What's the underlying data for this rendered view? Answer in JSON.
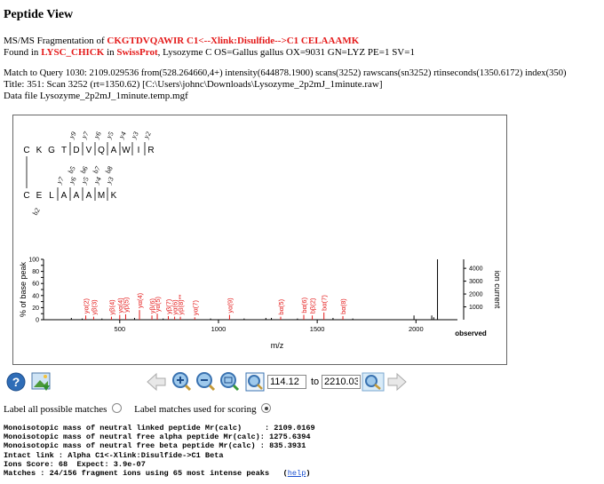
{
  "page_title": "Peptide View",
  "frag": {
    "prefix": "MS/MS Fragmentation of ",
    "peptide": "CKGTDVQAWIR C1<--Xlink:Disulfide-->C1 CELAAAMK"
  },
  "found": {
    "prefix": "Found in ",
    "accession": "LYSC_CHICK",
    "mid": " in ",
    "db": "SwissProt",
    "rest": ", Lysozyme C OS=Gallus gallus OX=9031 GN=LYZ PE=1 SV=1"
  },
  "match_line": "Match to Query 1030: 2109.029536 from(528.264660,4+) intensity(644878.1900) scans(3252) rawscans(sn3252) rtinseconds(1350.6172) index(350)",
  "title_line": "Title: 351: Scan 3252 (rt=1350.62) [C:\\Users\\johnc\\Downloads\\Lysozyme_2p2mJ_1minute.raw]",
  "datafile_line": "Data file Lysozyme_2p2mJ_1minute.temp.mgf",
  "alpha_seq": [
    "C",
    "K",
    "G",
    "T",
    "D",
    "V",
    "Q",
    "A",
    "W",
    "I",
    "R"
  ],
  "alpha_top_labels": [
    "y9",
    "y7",
    "y6",
    "y5",
    "y4",
    "y3",
    "y2"
  ],
  "alpha_bot_labels": [
    "b5",
    "b6",
    "b7",
    "b8"
  ],
  "beta_seq": [
    "C",
    "E",
    "L",
    "A",
    "A",
    "A",
    "M",
    "K"
  ],
  "beta_top_labels": [
    "y7",
    "y6",
    "y5",
    "y4",
    "y3"
  ],
  "beta_bot_labels": [
    "b2"
  ],
  "chart_data": {
    "type": "bar",
    "xlabel": "m/z",
    "ylabel": "% of base peak",
    "y2label": "ion current",
    "observed_label": "observed",
    "xlim": [
      114.12,
      2210.03
    ],
    "ylim": [
      0,
      100
    ],
    "y2lim": [
      0,
      4700
    ],
    "xticks": [
      500,
      1000,
      1500,
      2000
    ],
    "yticks": [
      0,
      10,
      20,
      30,
      40,
      50,
      60,
      70,
      80,
      90,
      100
    ],
    "y2ticks": [
      1000,
      2000,
      3000,
      4000
    ],
    "matched_color": "#e41a1a",
    "unmatched_color": "#000000",
    "matched_peaks": [
      {
        "mz": 328,
        "y": 7,
        "label": "yα(2)"
      },
      {
        "mz": 368,
        "y": 5,
        "label": "yβ(3)"
      },
      {
        "mz": 458,
        "y": 5,
        "label": "yβ(4)"
      },
      {
        "mz": 500,
        "y": 8,
        "label": "yα(4)"
      },
      {
        "mz": 530,
        "y": 9,
        "label": "yβ(5)"
      },
      {
        "mz": 600,
        "y": 16,
        "label": "yα(4)"
      },
      {
        "mz": 663,
        "y": 7,
        "label": "yβ(6)"
      },
      {
        "mz": 690,
        "y": 10,
        "label": "yα(5)"
      },
      {
        "mz": 746,
        "y": 6,
        "label": "yβ(7)"
      },
      {
        "mz": 778,
        "y": 5,
        "label": "yα(6)"
      },
      {
        "mz": 807,
        "y": 5,
        "label": "yβ(8)**"
      },
      {
        "mz": 880,
        "y": 4,
        "label": "yα(7)"
      },
      {
        "mz": 1056,
        "y": 8,
        "label": "yα(9)"
      },
      {
        "mz": 1315,
        "y": 5,
        "label": "bα(5)"
      },
      {
        "mz": 1432,
        "y": 8,
        "label": "bα(6)"
      },
      {
        "mz": 1475,
        "y": 7,
        "label": "bβ(2)"
      },
      {
        "mz": 1534,
        "y": 12,
        "label": "bα(7)"
      },
      {
        "mz": 1630,
        "y": 6,
        "label": "bα(8)"
      }
    ],
    "other_peaks": [
      {
        "mz": 255,
        "y": 3
      },
      {
        "mz": 310,
        "y": 2
      },
      {
        "mz": 410,
        "y": 2
      },
      {
        "mz": 575,
        "y": 3
      },
      {
        "mz": 720,
        "y": 2
      },
      {
        "mz": 960,
        "y": 2
      },
      {
        "mz": 1130,
        "y": 2
      },
      {
        "mz": 1240,
        "y": 3
      },
      {
        "mz": 1268,
        "y": 3
      },
      {
        "mz": 1400,
        "y": 2
      },
      {
        "mz": 1580,
        "y": 3
      },
      {
        "mz": 1680,
        "y": 2
      },
      {
        "mz": 1990,
        "y": 7
      },
      {
        "mz": 2080,
        "y": 7
      },
      {
        "mz": 2090,
        "y": 4
      },
      {
        "mz": 2109,
        "y": 100
      }
    ]
  },
  "range": {
    "from": "114.12",
    "to_label": "to",
    "to": "2210.03"
  },
  "radios": {
    "all_label": "Label all possible matches",
    "scoring_label": "Label matches used for scoring"
  },
  "mono_lines": [
    "Monoisotopic mass of neutral linked peptide Mr(calc)     : 2109.0169",
    "Monoisotopic mass of neutral free alpha peptide Mr(calc): 1275.6394",
    "Monoisotopic mass of neutral free beta peptide Mr(calc) : 835.3931",
    "Intact link : Alpha C1<-Xlink:Disulfide->C1 Beta",
    "Ions Score: 68  Expect: 3.9e-07"
  ],
  "matches_text": "Matches : 24/156 fragment ions using 65 most intense peaks   (",
  "help_label": "help",
  "matches_close": ")",
  "icons": {
    "help": "help-icon",
    "export": "export-image-icon",
    "back": "left-arrow-icon",
    "zoom_in": "zoom-in-icon",
    "zoom_out": "zoom-out-icon",
    "zoom_a": "zoom-region-icon",
    "zoom_b": "zoom-fit-icon",
    "zoom_go": "zoom-apply-icon",
    "forward": "right-arrow-icon"
  }
}
